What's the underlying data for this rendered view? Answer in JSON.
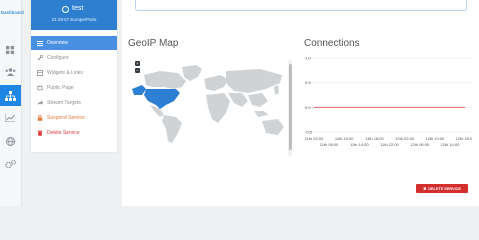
{
  "brand": {
    "logo_text": "Dashboard"
  },
  "service": {
    "name": "test",
    "time": "21:29:57 Europe/Paris"
  },
  "menu": {
    "items": [
      {
        "label": "Overview",
        "icon": "list-icon",
        "state": "active"
      },
      {
        "label": "Configure",
        "icon": "wrench-icon",
        "state": "normal"
      },
      {
        "label": "Widgets & Links",
        "icon": "widgets-icon",
        "state": "normal"
      },
      {
        "label": "Public Page",
        "icon": "page-icon",
        "state": "normal"
      },
      {
        "label": "Stream Targets",
        "icon": "share-icon",
        "state": "normal"
      },
      {
        "label": "Suspend Service",
        "icon": "lock-icon",
        "state": "warning"
      },
      {
        "label": "Delete Service",
        "icon": "trash-icon",
        "state": "danger"
      }
    ]
  },
  "rail": {
    "icons": [
      "dashboard-icon",
      "users-icon",
      "network-icon",
      "chart-icon",
      "globe-icon",
      "settings-icon"
    ],
    "active_index": 2
  },
  "geoip": {
    "title": "GeoIP Map",
    "zoom_in": "+",
    "zoom_out": "−",
    "highlight_color": "#2d7fd3"
  },
  "connections": {
    "title": "Connections"
  },
  "chart_data": {
    "type": "line",
    "title": "Connections",
    "ylim": [
      -0.5,
      1.0
    ],
    "y_ticks": [
      "1.0",
      "0.5",
      "0.0",
      "-0.5"
    ],
    "x": [
      "11th 02:00",
      "11th 06:00",
      "11th 10:00",
      "11th 14:00",
      "11th 18:00",
      "11th 22:00",
      "12th 02:00",
      "12th 06:00",
      "12th 10:00",
      "12th 14:00",
      "12th 18:00"
    ],
    "x_tick_rows": [
      [
        "11th 02:00",
        "11th 10:00",
        "11th 18:00",
        "12th 02:00",
        "12th 10:00",
        "12th 18:00"
      ],
      [
        "11th 06:00",
        "11th 14:00",
        "11th 22:00",
        "12th 06:00",
        "12th 14:00"
      ]
    ],
    "series": [
      {
        "values": [
          0,
          0,
          0,
          0,
          0,
          0,
          0,
          0,
          0,
          0,
          0
        ],
        "color": "#d9534f"
      }
    ],
    "grid": true
  },
  "actions": {
    "delete_label": "DELETE SERVICE"
  }
}
